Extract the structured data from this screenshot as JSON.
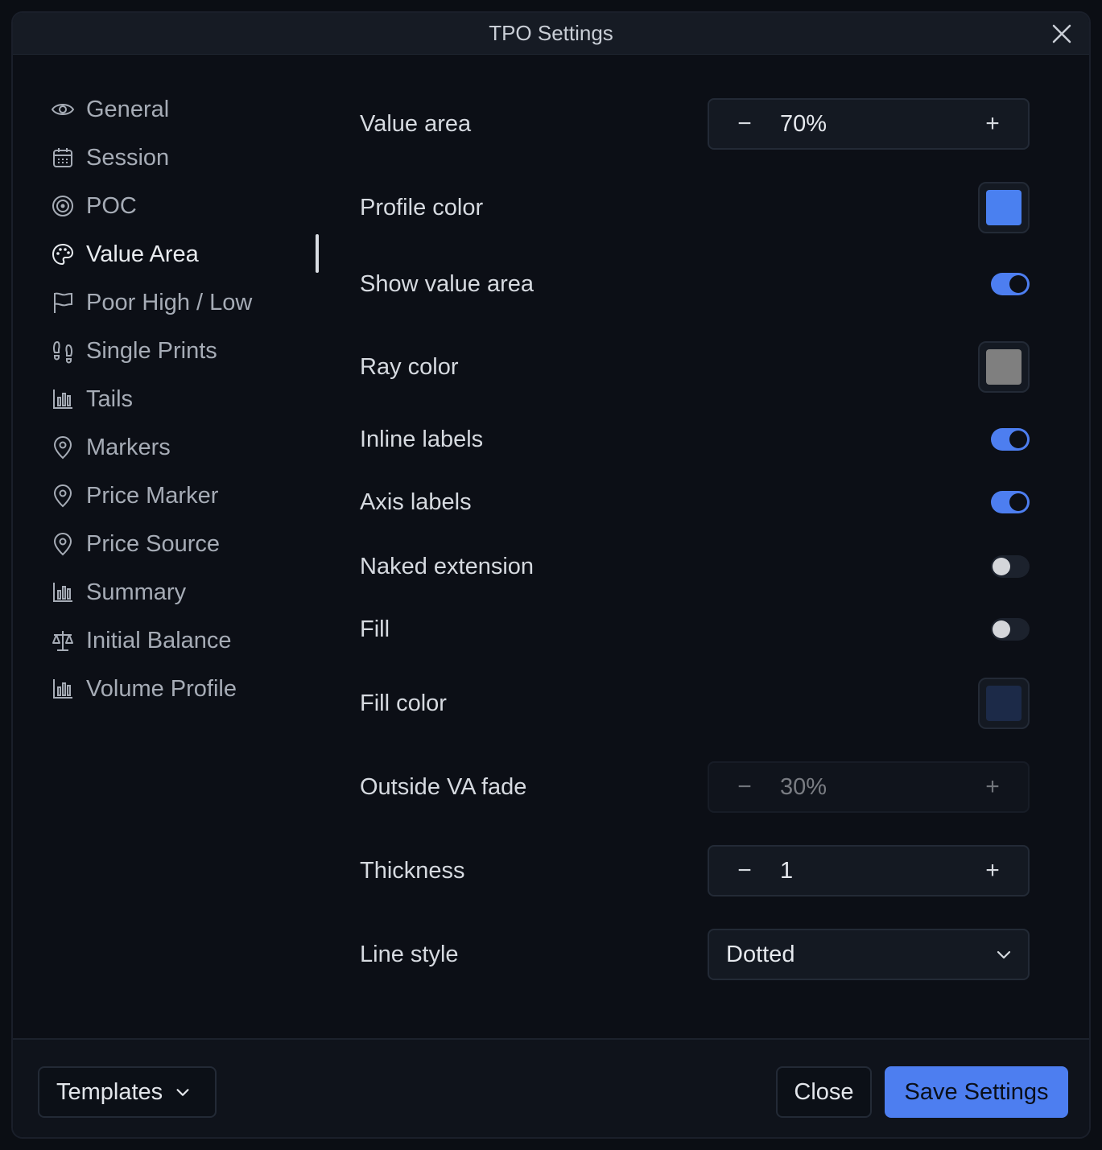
{
  "dialog": {
    "title": "TPO Settings",
    "close_icon": "close-icon"
  },
  "sidebar": {
    "items": [
      {
        "label": "General",
        "icon": "eye-icon",
        "active": false
      },
      {
        "label": "Session",
        "icon": "calendar-icon",
        "active": false
      },
      {
        "label": "POC",
        "icon": "target-icon",
        "active": false
      },
      {
        "label": "Value Area",
        "icon": "palette-icon",
        "active": true
      },
      {
        "label": "Poor High / Low",
        "icon": "flag-icon",
        "active": false
      },
      {
        "label": "Single Prints",
        "icon": "footprints-icon",
        "active": false
      },
      {
        "label": "Tails",
        "icon": "bar-chart-icon",
        "active": false
      },
      {
        "label": "Markers",
        "icon": "map-pin-icon",
        "active": false
      },
      {
        "label": "Price Marker",
        "icon": "map-pin-icon",
        "active": false
      },
      {
        "label": "Price Source",
        "icon": "map-pin-icon",
        "active": false
      },
      {
        "label": "Summary",
        "icon": "bar-chart-icon",
        "active": false
      },
      {
        "label": "Initial Balance",
        "icon": "scale-icon",
        "active": false
      },
      {
        "label": "Volume Profile",
        "icon": "bar-chart-icon",
        "active": false
      }
    ]
  },
  "settings": {
    "value_area": {
      "label": "Value area",
      "value": "70%",
      "minus": "−",
      "plus": "+"
    },
    "profile_color": {
      "label": "Profile color",
      "color": "#4a80f0"
    },
    "show_value_area": {
      "label": "Show value area",
      "on": true
    },
    "ray_color": {
      "label": "Ray color",
      "color": "#7f7f7f"
    },
    "inline_labels": {
      "label": "Inline labels",
      "on": true
    },
    "axis_labels": {
      "label": "Axis labels",
      "on": true
    },
    "naked_extension": {
      "label": "Naked extension",
      "on": false
    },
    "fill": {
      "label": "Fill",
      "on": false
    },
    "fill_color": {
      "label": "Fill color",
      "color": "#1c2a48"
    },
    "outside_va_fade": {
      "label": "Outside VA fade",
      "value": "30%",
      "minus": "−",
      "plus": "+",
      "disabled": true
    },
    "thickness": {
      "label": "Thickness",
      "value": "1",
      "minus": "−",
      "plus": "+"
    },
    "line_style": {
      "label": "Line style",
      "value": "Dotted"
    }
  },
  "footer": {
    "templates_label": "Templates",
    "close_label": "Close",
    "save_label": "Save Settings"
  },
  "colors": {
    "accent": "#4d7ef0",
    "background": "#0c0f16"
  }
}
